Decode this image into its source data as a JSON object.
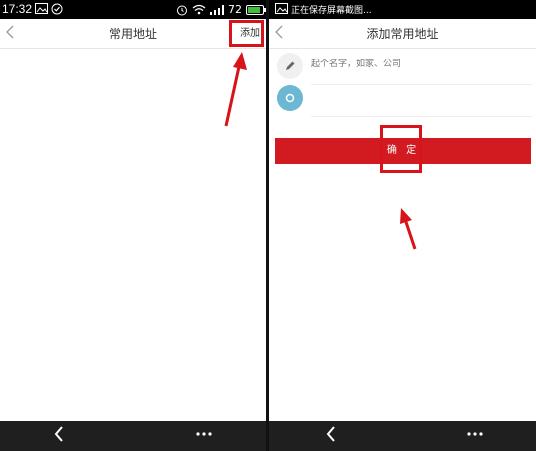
{
  "left_screen": {
    "status": {
      "time": "17:32",
      "battery": "72"
    },
    "header": {
      "back_icon": "chevron-left-icon",
      "title": "常用地址",
      "action": "添加"
    }
  },
  "right_screen": {
    "status": {
      "notification": "正在保存屏幕截图..."
    },
    "header": {
      "back_icon": "chevron-left-icon",
      "title": "添加常用地址"
    },
    "form": {
      "name_placeholder": "起个名字，如家、公司",
      "name_icon": "pencil-icon",
      "address_icon": "location-icon",
      "address_placeholder": ""
    },
    "confirm_label": "确 定"
  },
  "colors": {
    "accent": "#d11b21",
    "highlight": "#d6141a",
    "location_icon": "#6cb7d1"
  }
}
